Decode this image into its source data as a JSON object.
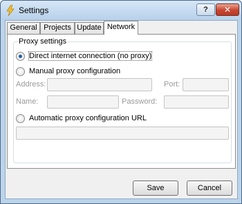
{
  "window": {
    "title": "Settings",
    "help_label": "?",
    "close_label": "✕"
  },
  "tabs": [
    {
      "label": "General",
      "active": false
    },
    {
      "label": "Projects",
      "active": false
    },
    {
      "label": "Update",
      "active": false
    },
    {
      "label": "Network",
      "active": true
    }
  ],
  "proxy": {
    "group_label": "Proxy settings",
    "direct_label": "Direct internet connection (no proxy)",
    "direct_checked": true,
    "manual_label": "Manual proxy configuration",
    "manual_checked": false,
    "auto_label": "Automatic proxy configuration URL",
    "auto_checked": false,
    "address_label": "Address:",
    "address_value": "",
    "port_label": "Port:",
    "port_value": "",
    "name_label": "Name:",
    "name_value": "",
    "password_label": "Password:",
    "password_value": "",
    "url_value": ""
  },
  "buttons": {
    "save": "Save",
    "cancel": "Cancel"
  },
  "icons": {
    "app": "lightning-bolt-icon",
    "help": "help-icon",
    "close": "close-icon"
  },
  "colors": {
    "title_bar": "#c6dbf0",
    "close_button": "#c84530",
    "radio_dot": "#1e5aa8"
  }
}
